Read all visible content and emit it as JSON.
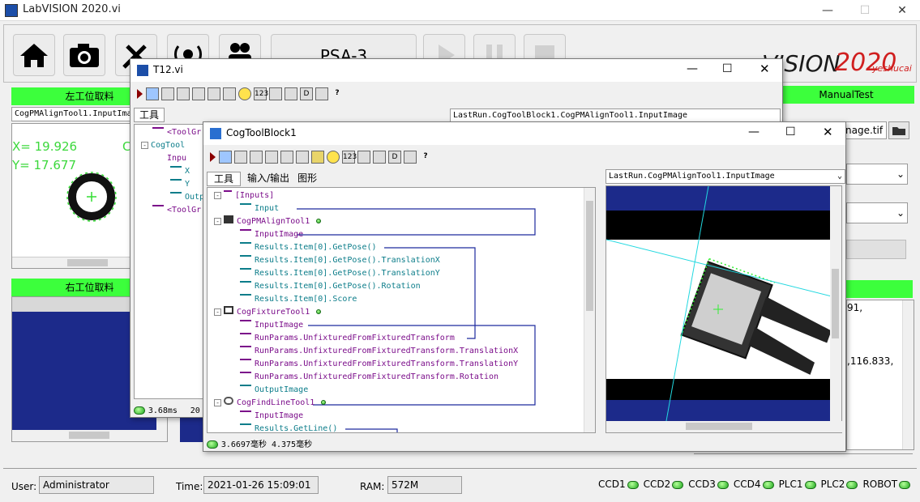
{
  "app": {
    "title": "LabVISION 2020.vi"
  },
  "logo": {
    "text": "VISION",
    "year": "2020",
    "author": "yeshucai"
  },
  "center_button": {
    "label": "PSA-3"
  },
  "left_station": {
    "title": "左工位取料",
    "combo": "CogPMAlignTool1.InputIma",
    "x_readout": "X= 19.926",
    "y_readout": "Y= 17.677",
    "c_label": "C"
  },
  "right_station": {
    "title": "右工位取料"
  },
  "manual": {
    "title": "ManualTest",
    "file": "nage.tif",
    "result1": "91,",
    "result2": ",116.833,"
  },
  "t12": {
    "title": "T12.vi",
    "tab_tools": "工具",
    "combo": "LastRun.CogToolBlock1.CogPMAlignTool1.InputImage",
    "status_time": "3.68ms",
    "status_extra": "20",
    "tree": [
      "<ToolGr",
      "CogTool",
      "Inpu",
      "X",
      "Y",
      "Outp",
      "<ToolGr"
    ]
  },
  "toolblock": {
    "title": "CogToolBlock1",
    "tabs": [
      "工具",
      "输入/输出",
      "图形"
    ],
    "combo": "LastRun.CogPMAlignTool1.InputImage",
    "status": "3.6697毫秒 4.375毫秒",
    "tree": [
      "[Inputs]",
      "Input",
      "CogPMAlignTool1",
      "InputImage",
      "Results.Item[0].GetPose()",
      "Results.Item[0].GetPose().TranslationX",
      "Results.Item[0].GetPose().TranslationY",
      "Results.Item[0].GetPose().Rotation",
      "Results.Item[0].Score",
      "CogFixtureTool1",
      "InputImage",
      "RunParams.UnfixturedFromFixturedTransform",
      "RunParams.UnfixturedFromFixturedTransform.TranslationX",
      "RunParams.UnfixturedFromFixturedTransform.TranslationY",
      "RunParams.UnfixturedFromFixturedTransform.Rotation",
      "OutputImage",
      "CogFindLineTool1",
      "InputImage",
      "Results.GetLine()"
    ]
  },
  "statusbar": {
    "user_label": "User:",
    "user": "Administrator",
    "time_label": "Time:",
    "time": "2021-01-26 15:09:01",
    "ram_label": "RAM:",
    "ram": "572M",
    "indicators": [
      "CCD1",
      "CCD2",
      "CCD3",
      "CCD4",
      "PLC1",
      "PLC2",
      "ROBOT"
    ]
  },
  "colors": {
    "green": "#3cff3c",
    "purple": "#7b0d8a",
    "teal": "#0c7d8a",
    "logo_red": "#d01f1f",
    "dark_blue": "#1c2a8a"
  }
}
